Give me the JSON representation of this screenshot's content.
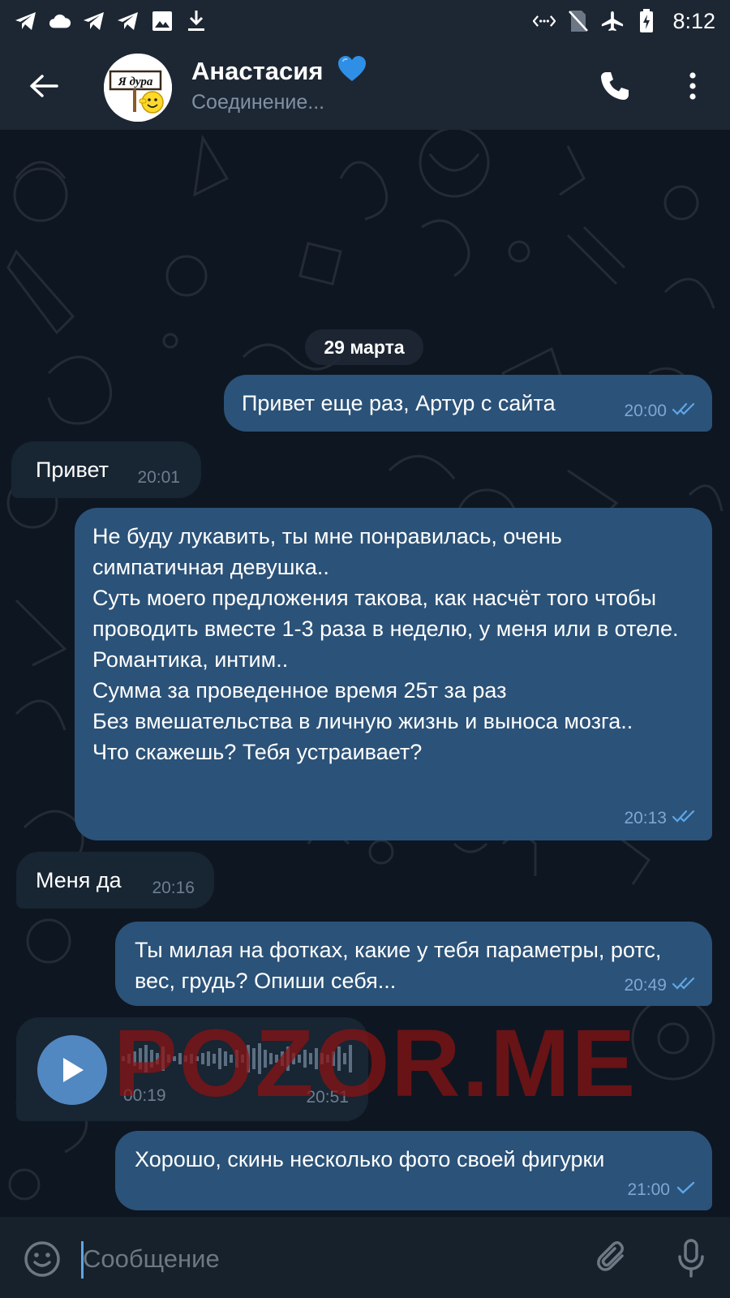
{
  "status_bar": {
    "time": "8:12",
    "left_icons": [
      "telegram-icon",
      "cloud-icon",
      "telegram-icon",
      "telegram-icon",
      "image-icon",
      "download-icon"
    ],
    "right_icons": [
      "data-saver-icon",
      "no-sim-icon",
      "airplane-icon",
      "battery-charging-icon"
    ]
  },
  "header": {
    "contact_name": "Анастасия",
    "status": "Соединение...",
    "avatar_text": "Я дура"
  },
  "date_separator": "29 марта",
  "messages": [
    {
      "direction": "out",
      "text": "Привет еще раз, Артур с сайта",
      "time": "20:00",
      "read": true
    },
    {
      "direction": "in",
      "text": "Привет",
      "time": "20:01"
    },
    {
      "direction": "out",
      "text": "Не буду лукавить, ты мне понравилась, очень симпатичная девушка..\nСуть моего предложения такова, как насчёт того чтобы проводить вместе 1-3 раза в неделю, у меня или в отеле.\nРомантика, интим..\nСумма за проведенное время 25т за раз\nБез вмешательства в личную жизнь и выноса мозга..\nЧто скажешь? Тебя устраивает?",
      "time": "20:13",
      "read": true
    },
    {
      "direction": "in",
      "text": "Меня да",
      "time": "20:16"
    },
    {
      "direction": "out",
      "text": "Ты милая на фотках, какие у тебя параметры, ротс, вес, грудь? Опиши себя...",
      "time": "20:49",
      "read": true
    },
    {
      "direction": "in",
      "type": "voice",
      "duration": "00:19",
      "time": "20:51"
    },
    {
      "direction": "out",
      "text": "Хорошо, скинь несколько фото своей фигурки",
      "time": "21:00",
      "read": false
    }
  ],
  "watermark": "POZOR.ME",
  "input": {
    "placeholder": "Сообщение"
  },
  "colors": {
    "chat_background": "#0e1621",
    "header_background": "#1d2733",
    "outgoing_bubble": "#2b5278",
    "incoming_bubble": "#182533",
    "accent": "#5288c1",
    "watermark": "#8c1212"
  }
}
